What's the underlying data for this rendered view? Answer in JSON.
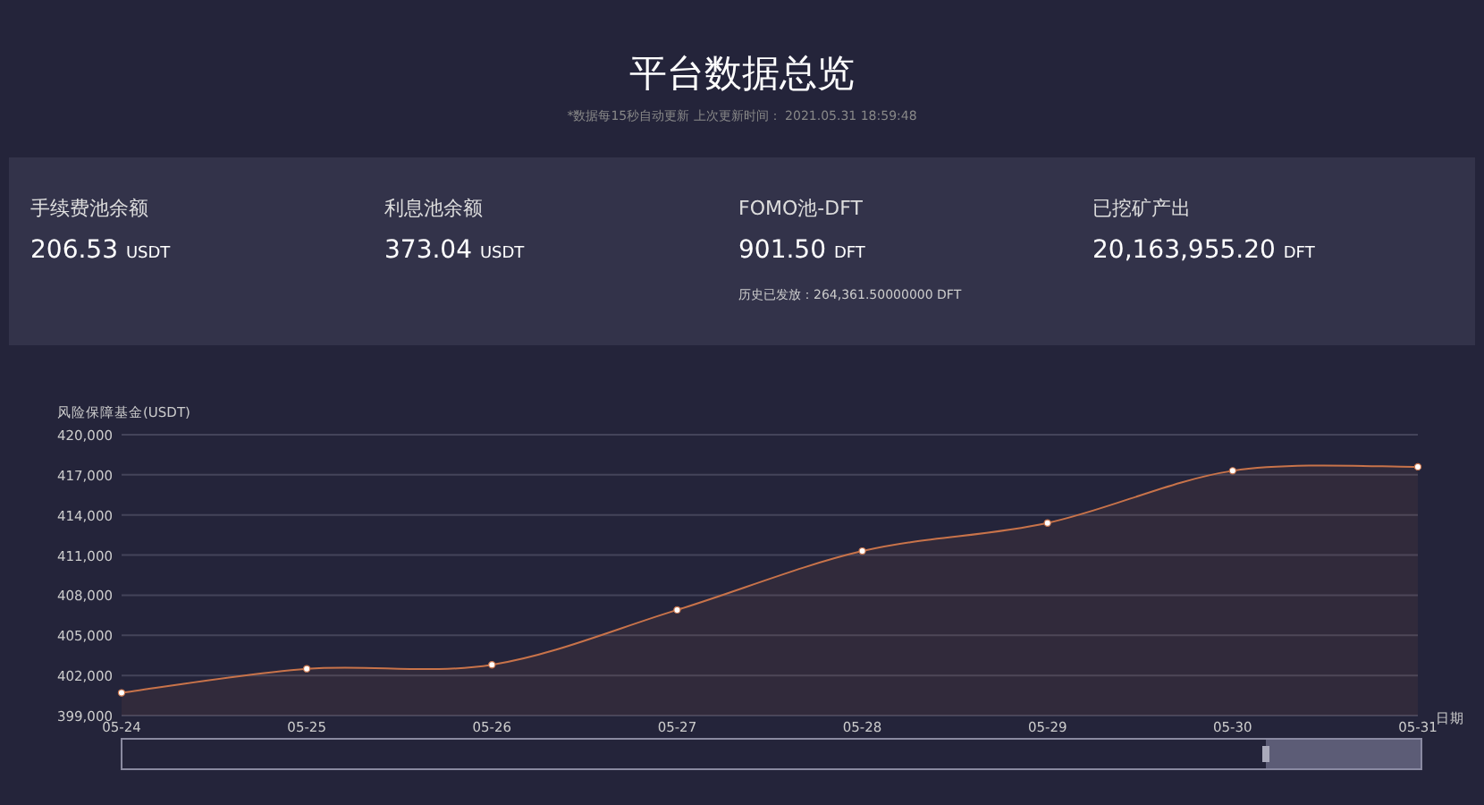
{
  "title": "平台数据总览",
  "subtitle": "*数据每15秒自动更新 上次更新时间： 2021.05.31 18:59:48",
  "stats": [
    {
      "label": "手续费池余额",
      "value": "206.53",
      "unit": "USDT"
    },
    {
      "label": "利息池余额",
      "value": "373.04",
      "unit": "USDT"
    },
    {
      "label": "FOMO池-DFT",
      "value": "901.50",
      "unit": "DFT",
      "note": "历史已发放：264,361.50000000 DFT"
    },
    {
      "label": "已挖矿产出",
      "value": "20,163,955.20",
      "unit": "DFT"
    }
  ],
  "chart": {
    "chart_data": {
      "type": "area",
      "grid": true,
      "ylabel": "风险保障基金(USDT)",
      "xlabel": "日期",
      "categories": [
        "05-24",
        "05-25",
        "05-26",
        "05-27",
        "05-28",
        "05-29",
        "05-30",
        "05-31"
      ],
      "series": [
        {
          "color": "#c8734a",
          "marker": true,
          "values": [
            400700,
            402500,
            402800,
            406900,
            411300,
            413400,
            417300,
            417600
          ]
        }
      ],
      "ylim": [
        399000,
        420000
      ],
      "yticks": [
        {
          "value": 399000,
          "label": "399,000"
        },
        {
          "value": 402000,
          "label": "402,000"
        },
        {
          "value": 405000,
          "label": "405,000"
        },
        {
          "value": 408000,
          "label": "408,000"
        },
        {
          "value": 411000,
          "label": "411,000"
        },
        {
          "value": 414000,
          "label": "414,000"
        },
        {
          "value": 417000,
          "label": "417,000"
        },
        {
          "value": 420000,
          "label": "420,000"
        }
      ]
    },
    "zoom": {
      "level": 0.12
    }
  }
}
